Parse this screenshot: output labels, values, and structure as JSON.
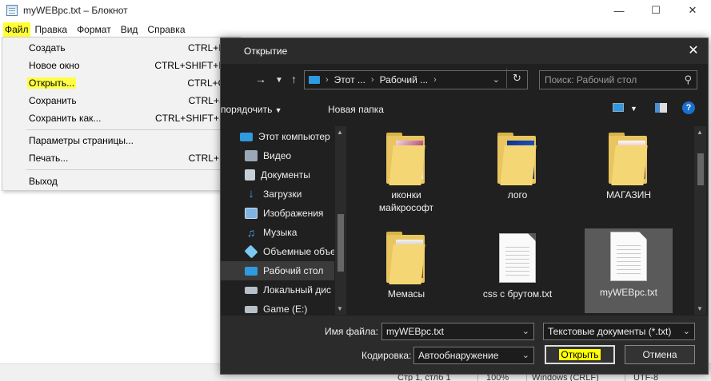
{
  "notepad": {
    "title": "myWEBpc.txt – Блокнот",
    "menu": [
      "Файл",
      "Правка",
      "Формат",
      "Вид",
      "Справка"
    ],
    "file_menu": [
      {
        "label": "Создать",
        "shortcut": "CTRL+N"
      },
      {
        "label": "Новое окно",
        "shortcut": "CTRL+SHIFT+N"
      },
      {
        "label": "Открыть...",
        "shortcut": "CTRL+O"
      },
      {
        "label": "Сохранить",
        "shortcut": "CTRL+S"
      },
      {
        "label": "Сохранить как...",
        "shortcut": "CTRL+SHIFT+S"
      },
      {
        "label": "Параметры страницы...",
        "shortcut": ""
      },
      {
        "label": "Печать...",
        "shortcut": "CTRL+P"
      },
      {
        "label": "Выход",
        "shortcut": ""
      }
    ],
    "status": {
      "position": "Стр 1, стлб 1",
      "zoom": "100%",
      "line_endings": "Windows (CRLF)",
      "encoding": "UTF-8"
    },
    "highlight_color": "#ffff33"
  },
  "dialog": {
    "title": "Открытие",
    "breadcrumb": [
      "Этот ...",
      "Рабочий ..."
    ],
    "search_placeholder": "Поиск: Рабочий стол",
    "toolbar": {
      "organize": "порядочить",
      "new_folder": "Новая папка"
    },
    "nav_items": [
      {
        "label": "Этот компьютер",
        "icon": "computer-icon"
      },
      {
        "label": "Видео",
        "icon": "video-icon"
      },
      {
        "label": "Документы",
        "icon": "documents-icon"
      },
      {
        "label": "Загрузки",
        "icon": "downloads-icon"
      },
      {
        "label": "Изображения",
        "icon": "pictures-icon"
      },
      {
        "label": "Музыка",
        "icon": "music-icon"
      },
      {
        "label": "Объемные объе",
        "icon": "3d-objects-icon"
      },
      {
        "label": "Рабочий стол",
        "icon": "desktop-icon"
      },
      {
        "label": "Локальный дис",
        "icon": "drive-icon"
      },
      {
        "label": "Game (E:)",
        "icon": "drive-icon"
      }
    ],
    "files": [
      {
        "label": "иконки\nмайкрософт",
        "type": "folder"
      },
      {
        "label": "лого",
        "type": "folder"
      },
      {
        "label": "МАГАЗИН",
        "type": "folder"
      },
      {
        "label": "Мемасы",
        "type": "folder"
      },
      {
        "label": "css с брутом.txt",
        "type": "text"
      },
      {
        "label": "myWEBpc.txt",
        "type": "text"
      }
    ],
    "filename_label": "Имя файла:",
    "filename_value": "myWEBpc.txt",
    "filetype_value": "Текстовые документы (*.txt)",
    "encoding_label": "Кодировка:",
    "encoding_value": "Автообнаружение",
    "open_button": "Открыть",
    "cancel_button": "Отмена",
    "accent_color": "#2f9ae0",
    "folder_color": "#f5d675"
  }
}
